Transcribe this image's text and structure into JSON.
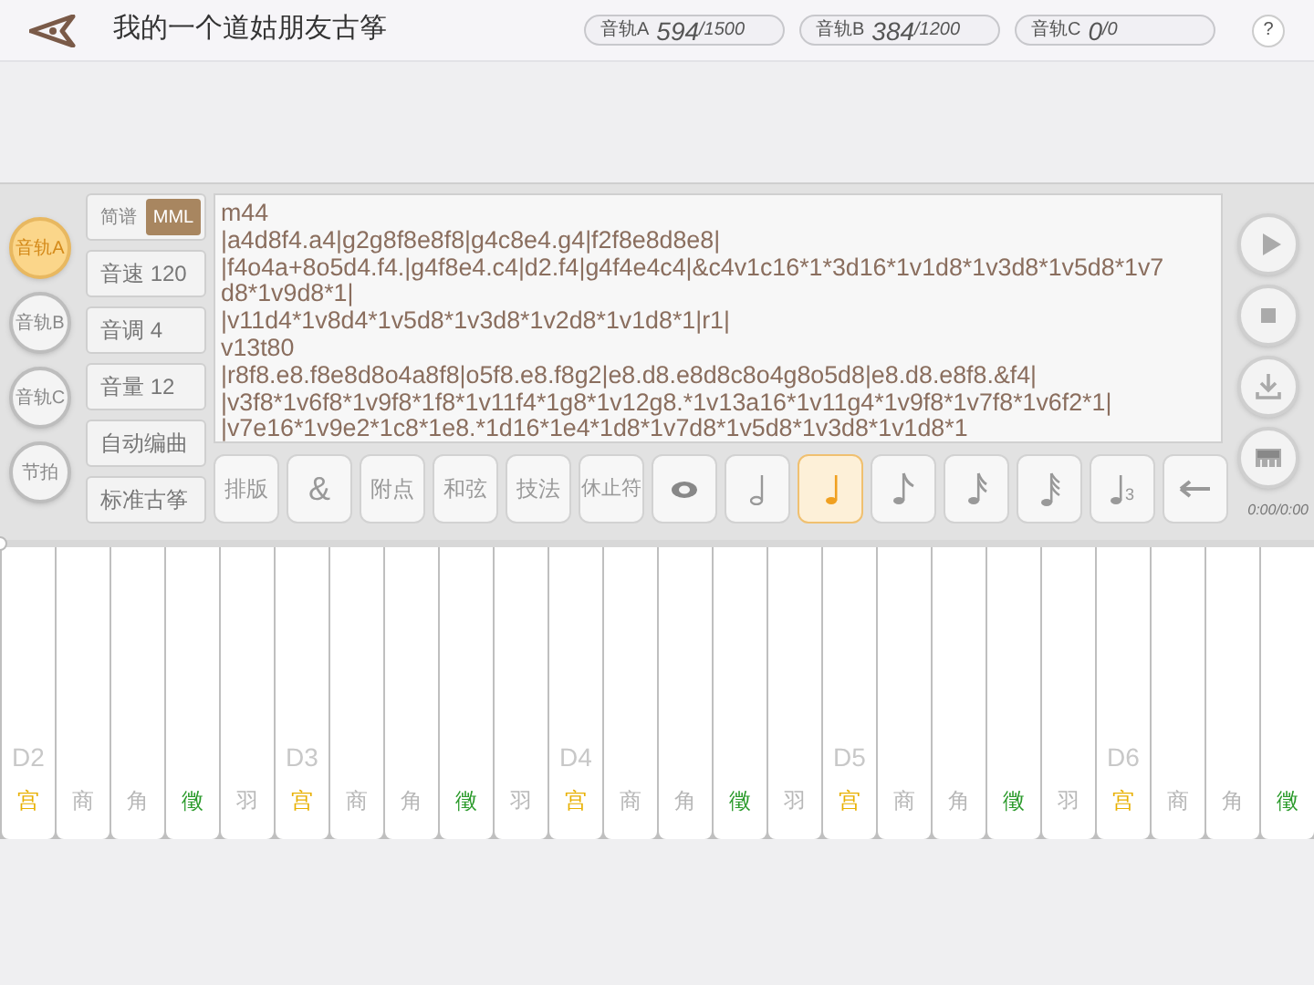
{
  "header": {
    "title": "我的一个道姑朋友古筝",
    "counters": [
      {
        "label": "音轨A",
        "value": "594",
        "max": "/1500"
      },
      {
        "label": "音轨B",
        "value": "384",
        "max": "/1200"
      },
      {
        "label": "音轨C",
        "value": "0",
        "max": "/0"
      }
    ],
    "help": "?"
  },
  "tracks": [
    {
      "label": "音轨A",
      "selected": true
    },
    {
      "label": "音轨B",
      "selected": false
    },
    {
      "label": "音轨C",
      "selected": false
    },
    {
      "label": "节拍",
      "selected": false
    }
  ],
  "notation_toggle": [
    {
      "label": "简谱",
      "selected": false
    },
    {
      "label": "MML",
      "selected": true
    }
  ],
  "settings": [
    "音速 120",
    "音调 4",
    "音量 12",
    "自动编曲",
    "标准古筝"
  ],
  "editor_lines": [
    "m44",
    "|a4d8f4.a4|g2g8f8e8f8|g4c8e4.g4|f2f8e8d8e8|",
    "|f4o4a+8o5d4.f4.|g4f8e4.c4|d2.f4|g4f4e4c4|&c4v1c16*1*3d16*1v1d8*1v3d8*1v5d8*1v7",
    "d8*1v9d8*1|",
    "|v11d4*1v8d4*1v5d8*1v3d8*1v2d8*1v1d8*1|r1|",
    "v13t80",
    "|r8f8.e8.f8e8d8o4a8f8|o5f8.e8.f8g2|e8.d8.e8d8c8o4g8o5d8|e8.d8.e8f8.&f4|",
    "|v3f8*1v6f8*1v9f8*1f8*1v11f4*1g8*1v12g8.*1v13a16*1v11g4*1v9f8*1v7f8*1v6f2*1|",
    "|v7e16*1v9e2*1c8*1e8.*1d16*1e4*1d8*1v7d8*1v5d8*1v3d8*1v1d8*1"
  ],
  "tools": [
    {
      "kind": "text",
      "label": "排版",
      "selected": false
    },
    {
      "kind": "text",
      "label": "&",
      "selected": false
    },
    {
      "kind": "text",
      "label": "附点",
      "selected": false
    },
    {
      "kind": "text",
      "label": "和弦",
      "selected": false
    },
    {
      "kind": "text",
      "label": "技法",
      "selected": false
    },
    {
      "kind": "text",
      "label": "休止符",
      "selected": false
    },
    {
      "kind": "whole",
      "selected": false
    },
    {
      "kind": "half",
      "selected": false
    },
    {
      "kind": "quarter",
      "selected": true
    },
    {
      "kind": "eighth",
      "selected": false
    },
    {
      "kind": "sixteenth",
      "selected": false
    },
    {
      "kind": "thirtysecond",
      "selected": false
    },
    {
      "kind": "triplet",
      "label": "3",
      "selected": false
    },
    {
      "kind": "backspace",
      "selected": false
    }
  ],
  "transport": [
    {
      "kind": "play"
    },
    {
      "kind": "stop"
    },
    {
      "kind": "download"
    },
    {
      "kind": "keyboard"
    }
  ],
  "time": "0:00/0:00",
  "progress": {
    "level": 0
  },
  "keys": [
    {
      "octave": "D2",
      "degree": "宫",
      "color": "#e8b000"
    },
    {
      "degree": "商",
      "color": "#b8b8b8"
    },
    {
      "degree": "角",
      "color": "#b8b8b8"
    },
    {
      "degree": "徵",
      "color": "#2a9a2a"
    },
    {
      "degree": "羽",
      "color": "#b8b8b8"
    },
    {
      "octave": "D3",
      "degree": "宫",
      "color": "#e8b000"
    },
    {
      "degree": "商",
      "color": "#b8b8b8"
    },
    {
      "degree": "角",
      "color": "#b8b8b8"
    },
    {
      "degree": "徵",
      "color": "#2a9a2a"
    },
    {
      "degree": "羽",
      "color": "#b8b8b8"
    },
    {
      "octave": "D4",
      "degree": "宫",
      "color": "#e8b000"
    },
    {
      "degree": "商",
      "color": "#b8b8b8"
    },
    {
      "degree": "角",
      "color": "#b8b8b8"
    },
    {
      "degree": "徵",
      "color": "#2a9a2a"
    },
    {
      "degree": "羽",
      "color": "#b8b8b8"
    },
    {
      "octave": "D5",
      "degree": "宫",
      "color": "#e8b000"
    },
    {
      "degree": "商",
      "color": "#b8b8b8"
    },
    {
      "degree": "角",
      "color": "#b8b8b8"
    },
    {
      "degree": "徵",
      "color": "#2a9a2a"
    },
    {
      "degree": "羽",
      "color": "#b8b8b8"
    },
    {
      "octave": "D6",
      "degree": "宫",
      "color": "#e8b000"
    },
    {
      "degree": "商",
      "color": "#b8b8b8"
    },
    {
      "degree": "角",
      "color": "#b8b8b8"
    },
    {
      "degree": "徵",
      "color": "#2a9a2a"
    }
  ]
}
